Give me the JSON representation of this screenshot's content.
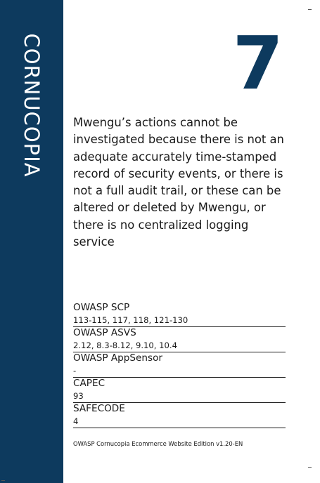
{
  "brand": {
    "name": "CORNUCOPIA",
    "color": "#0d3a5e"
  },
  "card": {
    "number": "7",
    "number_color": "#0d3a5e",
    "description": "Mwengu’s actions cannot be investigated because there is not an adequate accurately time-stamped record of security events, or there is not a full audit trail, or these can be altered or deleted by Mwengu, or there is no centralized logging service"
  },
  "mappings": [
    {
      "label": "OWASP SCP",
      "value": "113-115, 117, 118, 121-130"
    },
    {
      "label": "OWASP ASVS",
      "value": "2.12, 8.3-8.12, 9.10, 10.4"
    },
    {
      "label": "OWASP AppSensor",
      "value": "-"
    },
    {
      "label": "CAPEC",
      "value": "93"
    },
    {
      "label": "SAFECODE",
      "value": "4"
    }
  ],
  "footer": {
    "edition": "OWASP Cornucopia Ecommerce Website Edition v1.20-EN"
  }
}
